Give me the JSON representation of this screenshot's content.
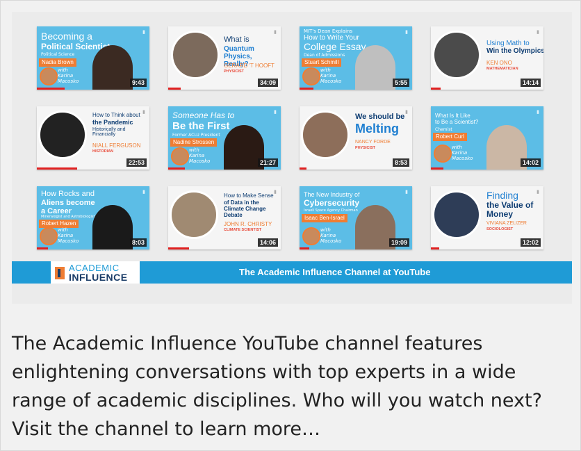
{
  "banner": {
    "logo_top": "ACADEMIC",
    "logo_bottom": "INFLUENCE",
    "strip_text": "The Academic Influence Channel at YouTube"
  },
  "videos": [
    {
      "pre": "",
      "title_1": "Becoming a",
      "title_2": "Political Scientist",
      "subtitle": "Political Science",
      "name": "Nadia Brown",
      "role": "",
      "host": "with Karina Macosko",
      "duration": "9:43"
    },
    {
      "pre": "",
      "title_1": "What is",
      "title_2": "Quantum Physics, Really?",
      "subtitle": "",
      "name": "GERARD 'T HOOFT",
      "role": "PHYSICIST",
      "host": "",
      "duration": "34:09"
    },
    {
      "pre": "MIT's Dean Explains",
      "title_1": "How to Write Your",
      "title_2": "College Essay",
      "subtitle": "Dean of Admissions",
      "name": "Stuart Schmill",
      "role": "",
      "host": "with Karina Macosko",
      "duration": "5:55"
    },
    {
      "pre": "",
      "title_1": "Using Math to",
      "title_2": "Win the Olympics",
      "subtitle": "",
      "name": "KEN ONO",
      "role": "MATHEMATICIAN",
      "host": "",
      "duration": "14:14"
    },
    {
      "pre": "",
      "title_1": "How to Think about",
      "title_2": "the Pandemic",
      "subtitle": "Historically and Financially",
      "name": "NIALL FERGUSON",
      "role": "HISTORIAN",
      "host": "",
      "duration": "22:53"
    },
    {
      "pre": "",
      "title_1": "Someone Has to",
      "title_2": "Be the First",
      "subtitle": "Former ACLU President",
      "name": "Nadine Strossen",
      "role": "",
      "host": "with Karina Macosko",
      "duration": "21:27"
    },
    {
      "pre": "",
      "title_1": "We should be",
      "title_2": "Melting",
      "subtitle": "",
      "name": "NANCY FORDE",
      "role": "PHYSICIST",
      "host": "",
      "duration": "8:53"
    },
    {
      "pre": "",
      "title_1": "What Is It Like",
      "title_2": "to Be a Scientist?",
      "subtitle": "Chemist",
      "name": "Robert Curl",
      "role": "",
      "host": "with Karina Macosko",
      "duration": "14:02"
    },
    {
      "pre": "",
      "title_1": "How Rocks and",
      "title_2": "Aliens become a Career",
      "subtitle": "Mineralogist and Astrobiologist",
      "name": "Robert Hazen",
      "role": "",
      "host": "with Karina Macosko",
      "duration": "8:03"
    },
    {
      "pre": "",
      "title_1": "How to Make Sense",
      "title_2": "of Data in the Climate Change Debate",
      "subtitle": "",
      "name": "JOHN R. CHRISTY",
      "role": "CLIMATE SCIENTIST",
      "host": "",
      "duration": "14:06"
    },
    {
      "pre": "",
      "title_1": "The New Industry of",
      "title_2": "Cybersecurity",
      "subtitle": "Israeli Space Agency Chairman",
      "name": "Isaac Ben-Israel",
      "role": "",
      "host": "with Karina Macosko",
      "duration": "19:09"
    },
    {
      "pre": "",
      "title_1": "Finding",
      "title_2": "the Value of Money",
      "subtitle": "",
      "name": "VIVIANA ZELIZER",
      "role": "SOCIOLOGIST",
      "host": "",
      "duration": "12:02"
    }
  ],
  "description": "The Academic Influence YouTube channel features enlightening conversations with top experts in a wide range of academic disciplines. Who will you watch next? Visit the channel to learn more…"
}
